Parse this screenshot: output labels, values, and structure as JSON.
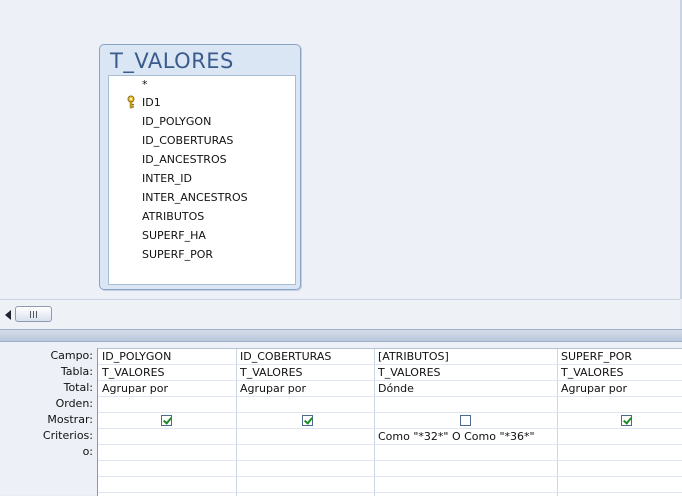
{
  "table": {
    "title": "T_VALORES",
    "fields": [
      "*",
      "ID1",
      "ID_POLYGON",
      "ID_COBERTURAS",
      "ID_ANCESTROS",
      "INTER_ID",
      "INTER_ANCESTROS",
      "ATRIBUTOS",
      "SUPERF_HA",
      "SUPERF_POR"
    ],
    "key_icon": "key-icon"
  },
  "scroll": {
    "arrow_icon": "arrow-left-icon"
  },
  "grid": {
    "row_labels": [
      "Campo:",
      "Tabla:",
      "Total:",
      "Orden:",
      "Mostrar:",
      "Criterios:",
      "o:"
    ],
    "columns": [
      {
        "campo": "ID_POLYGON",
        "tabla": "T_VALORES",
        "total": "Agrupar por",
        "orden": "",
        "mostrar": true,
        "criterios": "",
        "o": ""
      },
      {
        "campo": "ID_COBERTURAS",
        "tabla": "T_VALORES",
        "total": "Agrupar por",
        "orden": "",
        "mostrar": true,
        "criterios": "",
        "o": ""
      },
      {
        "campo": "[ATRIBUTOS]",
        "tabla": "T_VALORES",
        "total": "Dónde",
        "orden": "",
        "mostrar": false,
        "criterios": "Como \"*32*\" O Como \"*36*\"",
        "o": ""
      },
      {
        "campo": "SUPERF_POR",
        "tabla": "T_VALORES",
        "total": "Agrupar por",
        "orden": "",
        "mostrar": true,
        "criterios": "",
        "o": ""
      }
    ]
  }
}
